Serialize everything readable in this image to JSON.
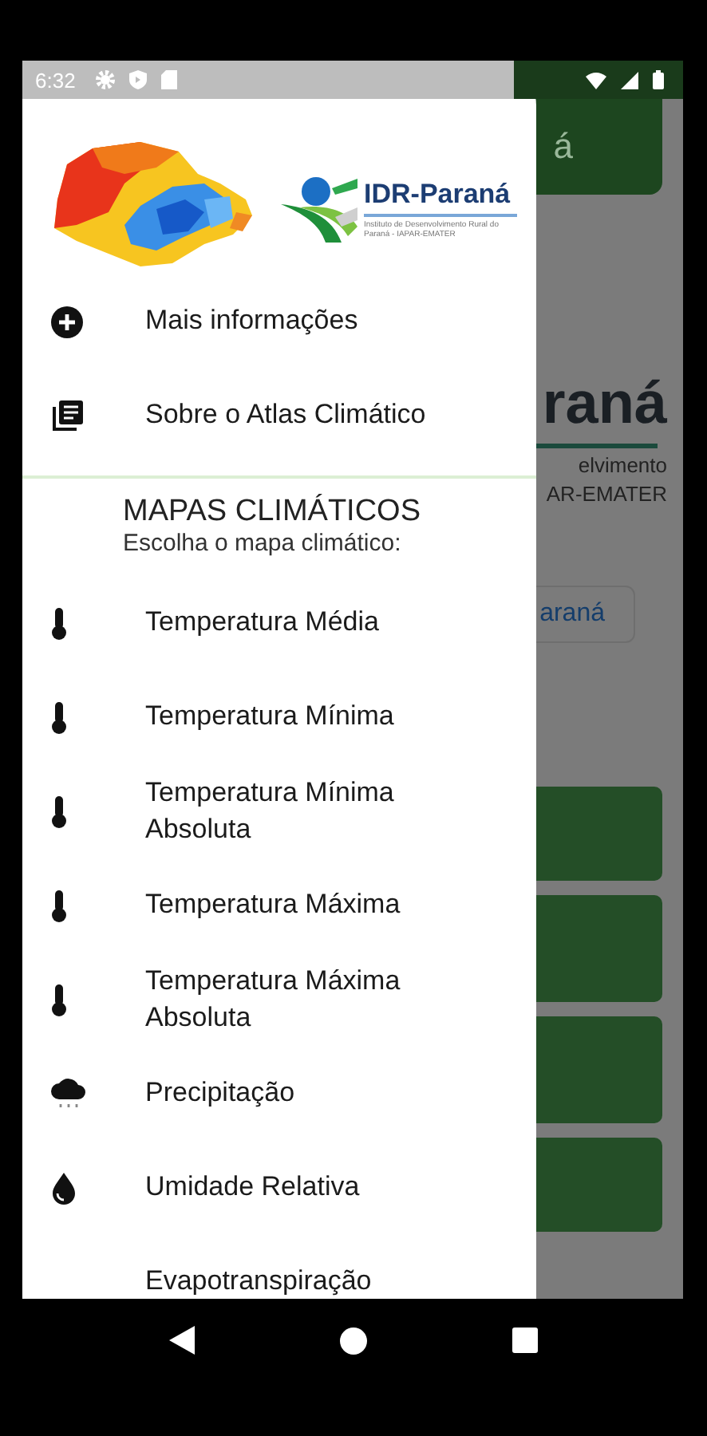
{
  "status_bar": {
    "time": "6:32"
  },
  "background_app": {
    "app_bar_title": "á",
    "heading": "raná",
    "subtitle_lines": [
      "elvimento",
      "AR-EMATER"
    ],
    "button": "araná"
  },
  "drawer": {
    "logo": {
      "name": "IDR-Paraná",
      "tagline": "Instituto de Desenvolvimento Rural do Paraná - IAPAR-EMATER"
    },
    "top_items": [
      {
        "label": "Mais informações",
        "kind": "add"
      },
      {
        "label": "Sobre o  Atlas Climático",
        "kind": "about"
      }
    ],
    "section": {
      "title": "MAPAS CLIMÁTICOS",
      "subtitle": "Escolha o mapa climático:"
    },
    "map_items": [
      {
        "label": "Temperatura Média",
        "kind": "temperature"
      },
      {
        "label": "Temperatura Mínima",
        "kind": "temperature"
      },
      {
        "label": "Temperatura Mínima Absoluta",
        "kind": "temperature"
      },
      {
        "label": "Temperatura Máxima",
        "kind": "temperature"
      },
      {
        "label": "Temperatura Máxima Absoluta",
        "kind": "temperature"
      },
      {
        "label": "Precipitação",
        "kind": "precipitation"
      },
      {
        "label": "Umidade Relativa",
        "kind": "humidity"
      },
      {
        "label": "Evapotranspiração"
      }
    ]
  }
}
